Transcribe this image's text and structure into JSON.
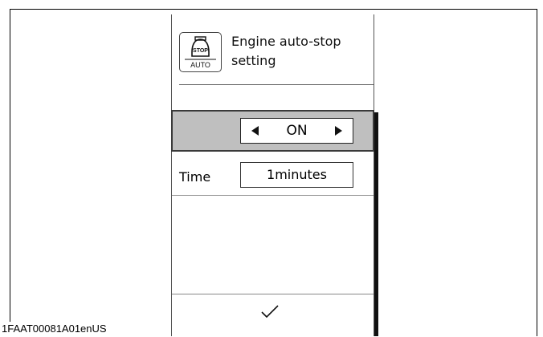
{
  "screen": {
    "title": "Engine auto-stop setting",
    "icon": {
      "name": "engine-auto-stop-icon",
      "top_text": "STOP",
      "bottom_text": "AUTO"
    },
    "selector": {
      "value": "ON"
    },
    "time": {
      "label": "Time",
      "value": "1minutes"
    },
    "confirm_icon": "checkmark-icon"
  },
  "reference_code": "1FAAT00081A01enUS"
}
